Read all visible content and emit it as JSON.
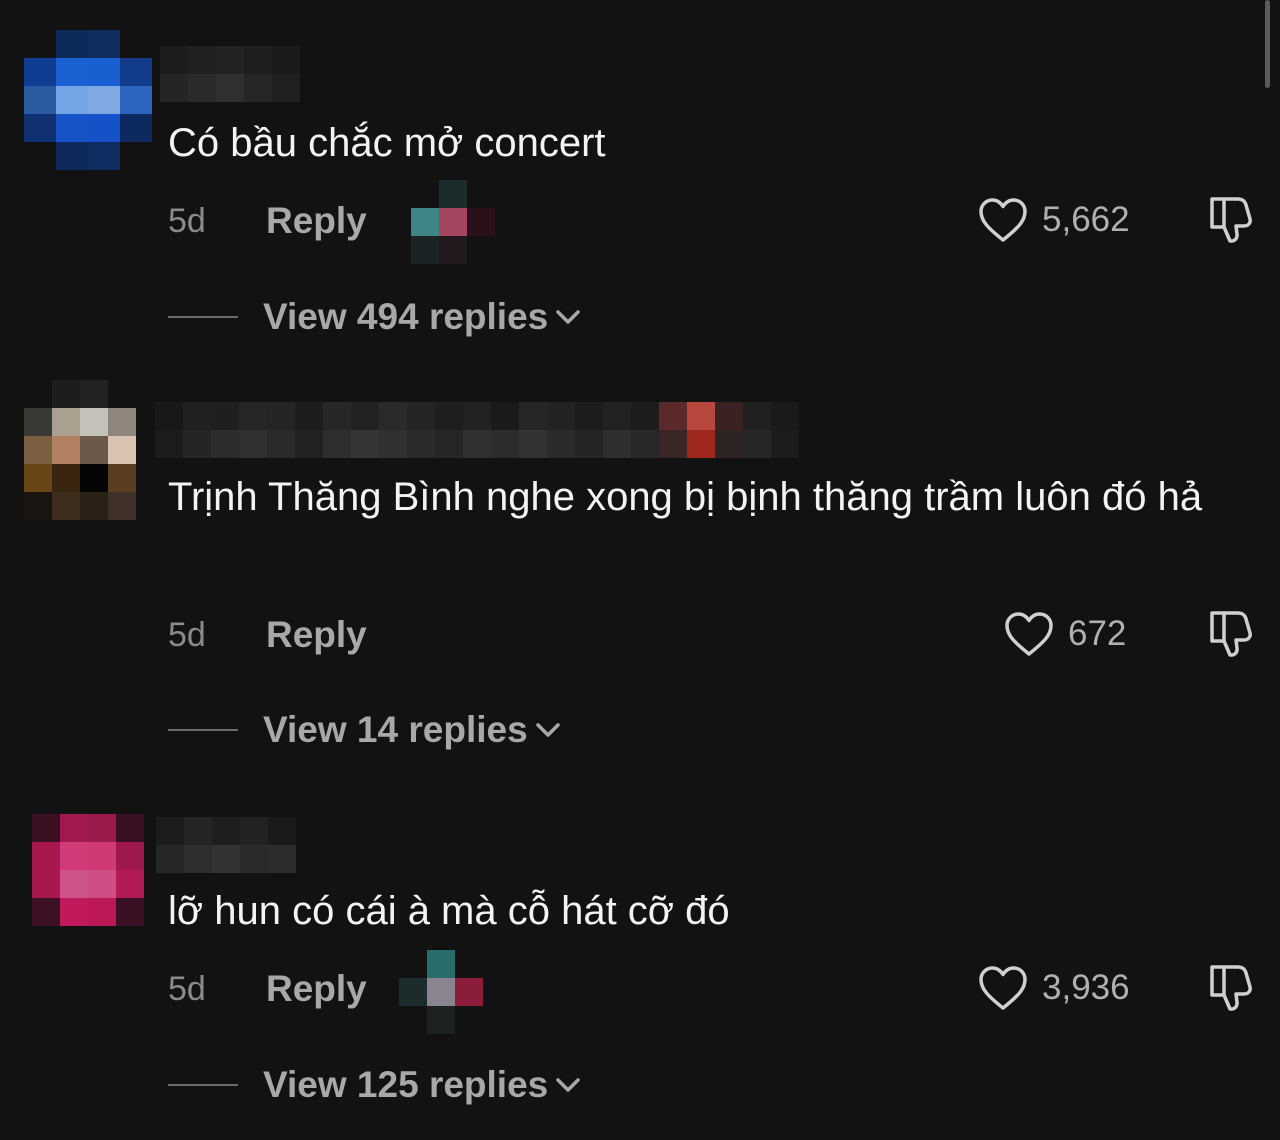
{
  "colors": {
    "background": "#121212",
    "text": "#f3f3f3",
    "muted": "#8a8a8a",
    "action": "#a8a8a8"
  },
  "comments": [
    {
      "text": "Có bầu chắc mở concert",
      "time": "5d",
      "reply_label": "Reply",
      "likes": "5,662",
      "view_replies": "View 494 replies",
      "has_sticker": true,
      "icons": [
        "avatar",
        "heart-icon",
        "dislike-icon",
        "chevron-down-icon"
      ]
    },
    {
      "text": "Trịnh Thăng Bình nghe xong bị bịnh thăng trầm luôn đó hả",
      "time": "5d",
      "reply_label": "Reply",
      "likes": "672",
      "view_replies": "View 14 replies",
      "has_sticker": false,
      "icons": [
        "avatar",
        "heart-icon",
        "dislike-icon",
        "chevron-down-icon"
      ]
    },
    {
      "text": "lỡ hun có cái à mà cỗ hát cỡ đó",
      "time": "5d",
      "reply_label": "Reply",
      "likes": "3,936",
      "view_replies": "View 125 replies",
      "has_sticker": true,
      "icons": [
        "avatar",
        "heart-icon",
        "dislike-icon",
        "chevron-down-icon"
      ]
    }
  ]
}
